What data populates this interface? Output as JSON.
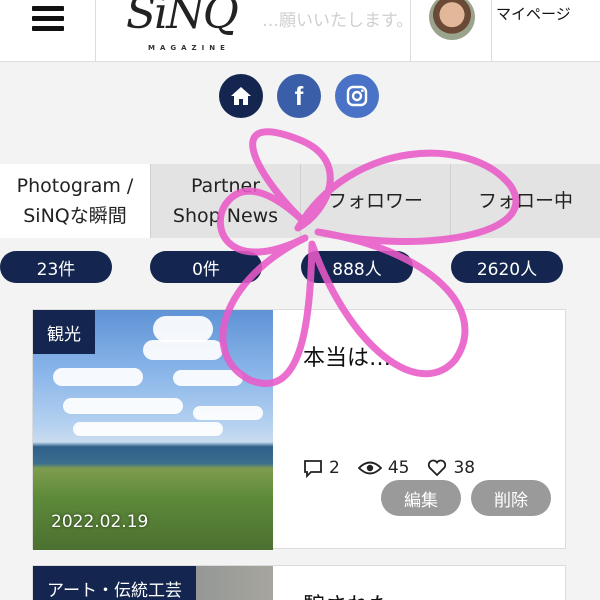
{
  "header": {
    "logo_text": "SiNQ",
    "logo_sub": "MAGAZINE",
    "faded_message": "…願いいたします。",
    "mypage_label": "マイページ"
  },
  "social": {
    "icons": [
      "home-icon",
      "facebook-icon",
      "instagram-icon"
    ],
    "facebook_glyph": "f"
  },
  "tabs": [
    {
      "line1": "Photogram /",
      "line2": "SiNQな瞬間",
      "count": "23件"
    },
    {
      "line1": "Partner",
      "line2": "Shop News",
      "count": "0件"
    },
    {
      "line1": "フォロワー",
      "line2": "",
      "count": "888人"
    },
    {
      "line1": "フォロー中",
      "line2": "",
      "count": "2620人"
    }
  ],
  "cards": [
    {
      "category": "観光",
      "title": "本当は…",
      "date": "2022.02.19",
      "comments": "2",
      "views": "45",
      "likes": "38",
      "edit_label": "編集",
      "delete_label": "削除"
    },
    {
      "category": "アート・伝統工芸",
      "title": "騙された…"
    }
  ],
  "colors": {
    "navy": "#14264f",
    "scribble": "#e85ac8",
    "button_grey": "#9a9a9a"
  }
}
